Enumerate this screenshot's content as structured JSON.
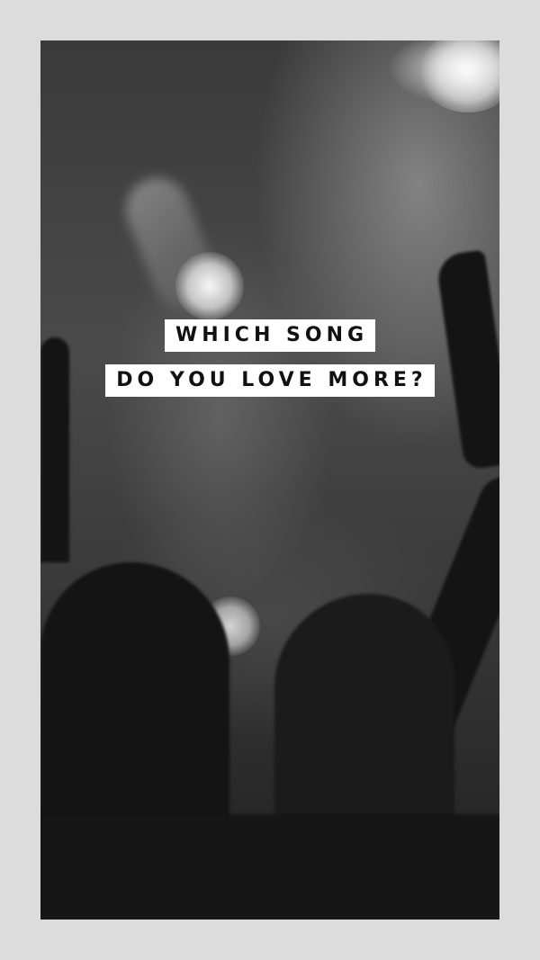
{
  "caption": {
    "line1": "WHICH SONG",
    "line2": "DO YOU LOVE MORE?"
  },
  "colors": {
    "border": "#dcdcdc",
    "caption_background": "#ffffff",
    "caption_text": "#111111"
  }
}
